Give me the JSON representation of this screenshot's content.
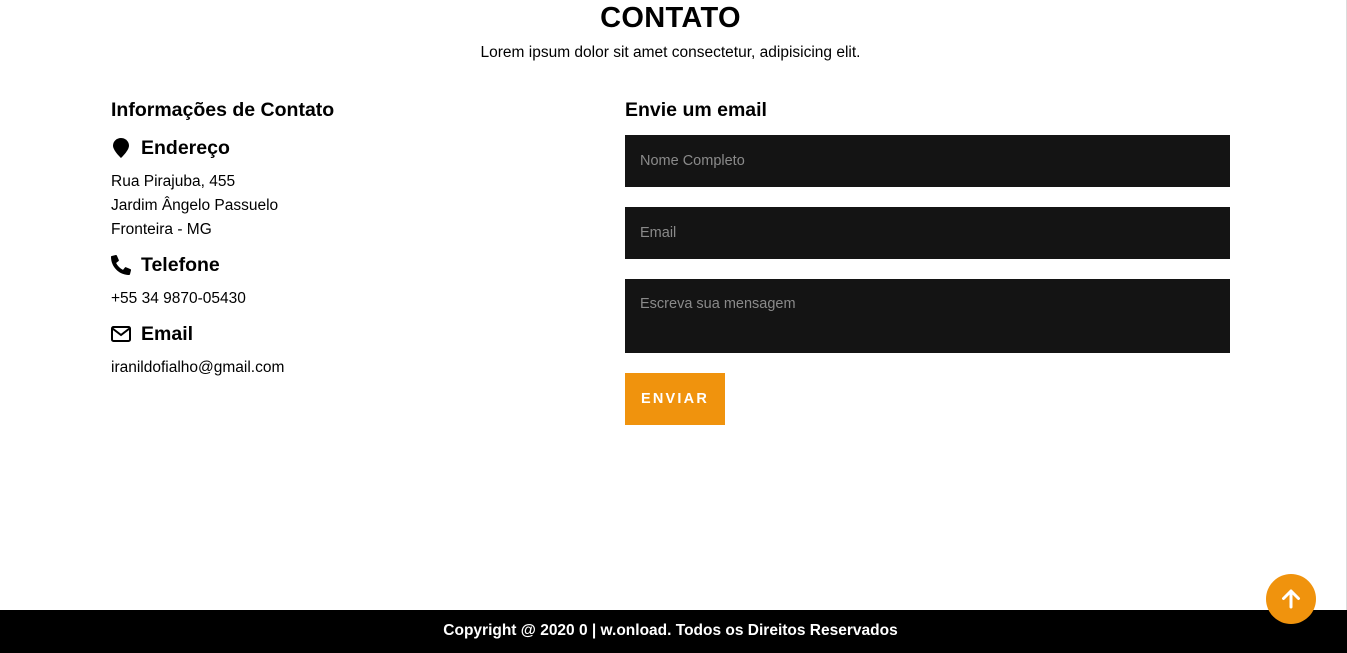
{
  "section": {
    "title": "CONTATO",
    "subtitle": "Lorem ipsum dolor sit amet consectetur, adipisicing elit."
  },
  "contact_info": {
    "heading": "Informações de Contato",
    "address": {
      "icon": "map-marker-icon",
      "title": "Endereço",
      "lines": [
        "Rua Pirajuba, 455",
        "Jardim Ângelo Passuelo",
        "Fronteira - MG"
      ]
    },
    "phone": {
      "icon": "phone-icon",
      "title": "Telefone",
      "value": "+55 34 9870-05430"
    },
    "email": {
      "icon": "envelope-icon",
      "title": "Email",
      "value": "iranildofialho@gmail.com"
    }
  },
  "form": {
    "heading": "Envie um email",
    "name_placeholder": "Nome Completo",
    "email_placeholder": "Email",
    "message_placeholder": "Escreva sua mensagem",
    "submit_label": "ENVIAR"
  },
  "footer": {
    "text": "Copyright @ 2020 0 | w.onload. Todos os Direitos Reservados"
  },
  "scroll_top": {
    "icon": "arrow-up-icon"
  },
  "colors": {
    "accent": "#f0930d",
    "field_bg": "#141414",
    "footer_bg": "#000000"
  }
}
